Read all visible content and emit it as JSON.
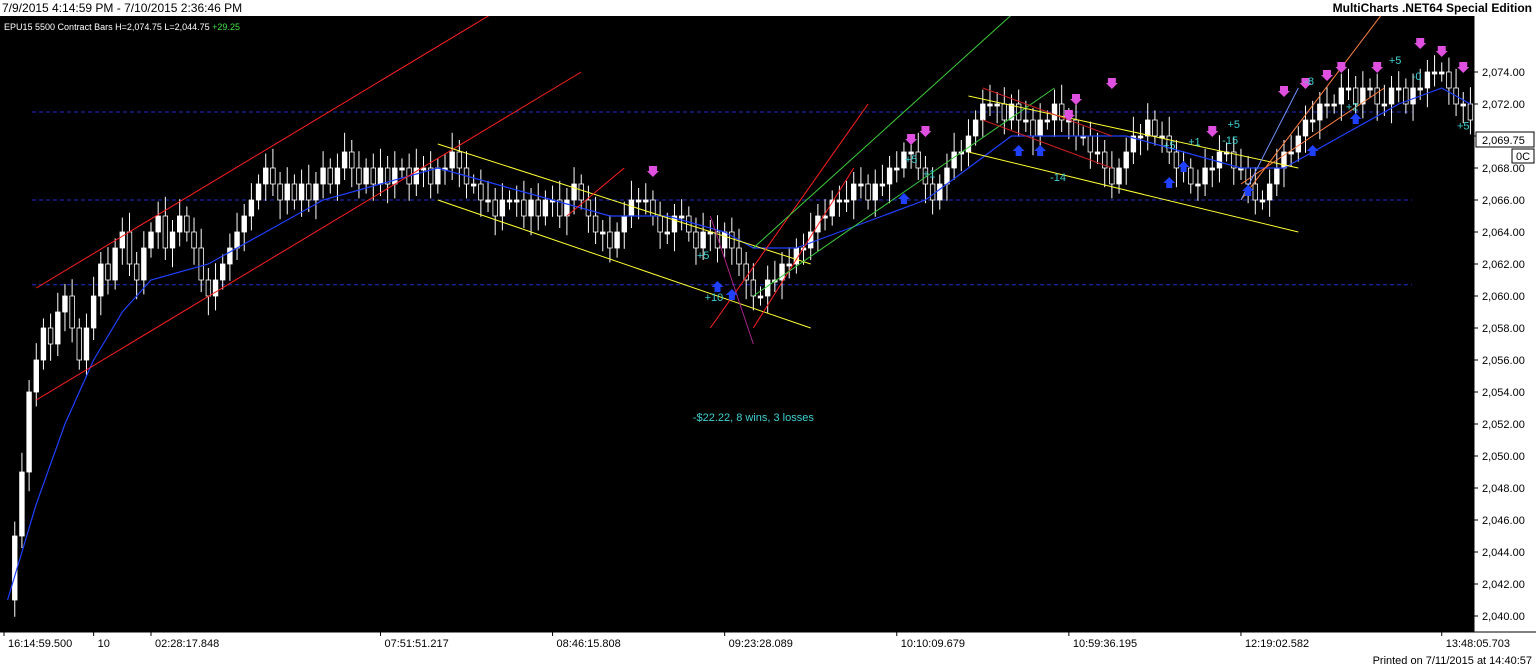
{
  "window": {
    "title_range": "7/9/2015 4:14:59 PM - 7/10/2015 2:36:46 PM",
    "app_name": "MultiCharts .NET64 Special Edition",
    "footer": "Printed on 7/11/2015 at 14:40:57"
  },
  "chart_data": {
    "type": "candlestick",
    "symbol_info": {
      "symbol": "EPU15",
      "bar_type": "5500 Contract Bars",
      "high": "H=2,074.75",
      "low": "L=2,044.75",
      "change": "+29.25"
    },
    "ylim": [
      2039,
      2077
    ],
    "y_ticks": [
      "2,040.00",
      "2,042.00",
      "2,044.00",
      "2,046.00",
      "2,048.00",
      "2,050.00",
      "2,052.00",
      "2,054.00",
      "2,056.00",
      "2,058.00",
      "2,060.00",
      "2,062.00",
      "2,064.00",
      "2,066.00",
      "2,068.00",
      "2,070.00",
      "2,072.00",
      "2,074.00"
    ],
    "y_tick_values": [
      2040,
      2042,
      2044,
      2046,
      2048,
      2050,
      2052,
      2054,
      2056,
      2058,
      2060,
      2062,
      2064,
      2066,
      2068,
      2070,
      2072,
      2074
    ],
    "last_price_label": "2,069.75",
    "last_price": 2069.75,
    "side_label": "0C",
    "x_ticks": [
      "16:14:59.500",
      "10",
      "02:28:17.848",
      "07:51:51.217",
      "08:46:15.808",
      "09:23:28.089",
      "10:10:09.679",
      "10:59:36.195",
      "12:19:02.582",
      "13:48:05.703"
    ],
    "x_tick_bars": [
      0,
      12,
      20,
      52,
      76,
      100,
      124,
      148,
      172,
      200
    ],
    "horizontal_levels": [
      2071.5,
      2066.0,
      2060.7
    ],
    "close_path": [
      [
        0,
        2041
      ],
      [
        1,
        2045
      ],
      [
        2,
        2049
      ],
      [
        3,
        2054
      ],
      [
        4,
        2056
      ],
      [
        5,
        2058
      ],
      [
        6,
        2057
      ],
      [
        7,
        2059
      ],
      [
        8,
        2060
      ],
      [
        9,
        2058
      ],
      [
        10,
        2056
      ],
      [
        11,
        2058
      ],
      [
        12,
        2060
      ],
      [
        13,
        2062
      ],
      [
        14,
        2061
      ],
      [
        15,
        2063
      ],
      [
        16,
        2064
      ],
      [
        17,
        2062
      ],
      [
        18,
        2061
      ],
      [
        19,
        2063
      ],
      [
        20,
        2064
      ],
      [
        21,
        2065
      ],
      [
        22,
        2063
      ],
      [
        23,
        2064
      ],
      [
        24,
        2065
      ],
      [
        25,
        2064
      ],
      [
        26,
        2063
      ],
      [
        27,
        2061
      ],
      [
        28,
        2060
      ],
      [
        29,
        2061
      ],
      [
        30,
        2062
      ],
      [
        31,
        2063
      ],
      [
        32,
        2064
      ],
      [
        33,
        2065
      ],
      [
        34,
        2066
      ],
      [
        35,
        2067
      ],
      [
        36,
        2068
      ],
      [
        37,
        2067
      ],
      [
        38,
        2066
      ],
      [
        39,
        2067
      ],
      [
        40,
        2066
      ],
      [
        41,
        2067
      ],
      [
        42,
        2066
      ],
      [
        43,
        2067
      ],
      [
        44,
        2068
      ],
      [
        45,
        2067
      ],
      [
        46,
        2068
      ],
      [
        47,
        2069
      ],
      [
        48,
        2068
      ],
      [
        49,
        2067
      ],
      [
        50,
        2068
      ],
      [
        51,
        2067
      ],
      [
        52,
        2068
      ],
      [
        53,
        2067
      ],
      [
        54,
        2068
      ],
      [
        55,
        2068
      ],
      [
        56,
        2067
      ],
      [
        57,
        2068
      ],
      [
        58,
        2068
      ],
      [
        59,
        2067
      ],
      [
        60,
        2068
      ],
      [
        61,
        2068
      ],
      [
        62,
        2069
      ],
      [
        63,
        2068
      ],
      [
        64,
        2067
      ],
      [
        65,
        2067
      ],
      [
        66,
        2066
      ],
      [
        67,
        2066
      ],
      [
        68,
        2065
      ],
      [
        69,
        2066
      ],
      [
        70,
        2066
      ],
      [
        71,
        2066
      ],
      [
        72,
        2065
      ],
      [
        73,
        2066
      ],
      [
        74,
        2065
      ],
      [
        75,
        2066
      ],
      [
        76,
        2066
      ],
      [
        77,
        2065
      ],
      [
        78,
        2066
      ],
      [
        79,
        2067
      ],
      [
        80,
        2066
      ],
      [
        81,
        2065
      ],
      [
        82,
        2064
      ],
      [
        83,
        2064
      ],
      [
        84,
        2063
      ],
      [
        85,
        2064
      ],
      [
        86,
        2065
      ],
      [
        87,
        2066
      ],
      [
        88,
        2066
      ],
      [
        89,
        2066
      ],
      [
        90,
        2065
      ],
      [
        91,
        2064
      ],
      [
        92,
        2064
      ],
      [
        93,
        2065
      ],
      [
        94,
        2065
      ],
      [
        95,
        2064
      ],
      [
        96,
        2063
      ],
      [
        97,
        2064
      ],
      [
        98,
        2064
      ],
      [
        99,
        2063
      ],
      [
        100,
        2064
      ],
      [
        101,
        2063
      ],
      [
        102,
        2062
      ],
      [
        103,
        2061
      ],
      [
        104,
        2060
      ],
      [
        105,
        2060
      ],
      [
        106,
        2061
      ],
      [
        107,
        2061
      ],
      [
        108,
        2062
      ],
      [
        109,
        2062
      ],
      [
        110,
        2063
      ],
      [
        111,
        2063
      ],
      [
        112,
        2064
      ],
      [
        113,
        2065
      ],
      [
        114,
        2065
      ],
      [
        115,
        2066
      ],
      [
        116,
        2066
      ],
      [
        117,
        2066
      ],
      [
        118,
        2067
      ],
      [
        119,
        2067
      ],
      [
        120,
        2066
      ],
      [
        121,
        2067
      ],
      [
        122,
        2067
      ],
      [
        123,
        2068
      ],
      [
        124,
        2068
      ],
      [
        125,
        2069
      ],
      [
        126,
        2069
      ],
      [
        127,
        2068
      ],
      [
        128,
        2067
      ],
      [
        129,
        2066
      ],
      [
        130,
        2067
      ],
      [
        131,
        2068
      ],
      [
        132,
        2069
      ],
      [
        133,
        2069
      ],
      [
        134,
        2070
      ],
      [
        135,
        2071
      ],
      [
        136,
        2072
      ],
      [
        137,
        2072
      ],
      [
        138,
        2072
      ],
      [
        139,
        2071
      ],
      [
        140,
        2072
      ],
      [
        141,
        2071
      ],
      [
        142,
        2071
      ],
      [
        143,
        2070
      ],
      [
        144,
        2071
      ],
      [
        145,
        2071
      ],
      [
        146,
        2072
      ],
      [
        147,
        2071
      ],
      [
        148,
        2071
      ],
      [
        149,
        2070
      ],
      [
        150,
        2070
      ],
      [
        151,
        2069
      ],
      [
        152,
        2069
      ],
      [
        153,
        2068
      ],
      [
        154,
        2067
      ],
      [
        155,
        2068
      ],
      [
        156,
        2069
      ],
      [
        157,
        2070
      ],
      [
        158,
        2070
      ],
      [
        159,
        2071
      ],
      [
        160,
        2070
      ],
      [
        161,
        2070
      ],
      [
        162,
        2069
      ],
      [
        163,
        2068
      ],
      [
        164,
        2068
      ],
      [
        165,
        2067
      ],
      [
        166,
        2067
      ],
      [
        167,
        2068
      ],
      [
        168,
        2068
      ],
      [
        169,
        2069
      ],
      [
        170,
        2069
      ],
      [
        171,
        2068
      ],
      [
        172,
        2068
      ],
      [
        173,
        2067
      ],
      [
        174,
        2066
      ],
      [
        175,
        2066
      ],
      [
        176,
        2067
      ],
      [
        177,
        2068
      ],
      [
        178,
        2069
      ],
      [
        179,
        2069
      ],
      [
        180,
        2070
      ],
      [
        181,
        2071
      ],
      [
        182,
        2071
      ],
      [
        183,
        2072
      ],
      [
        184,
        2072
      ],
      [
        185,
        2072
      ],
      [
        186,
        2073
      ],
      [
        187,
        2073
      ],
      [
        188,
        2072
      ],
      [
        189,
        2073
      ],
      [
        190,
        2073
      ],
      [
        191,
        2072
      ],
      [
        192,
        2072
      ],
      [
        193,
        2073
      ],
      [
        194,
        2073
      ],
      [
        195,
        2072
      ],
      [
        196,
        2073
      ],
      [
        197,
        2073
      ],
      [
        198,
        2074
      ],
      [
        199,
        2074
      ],
      [
        200,
        2074
      ],
      [
        201,
        2073
      ],
      [
        202,
        2072
      ],
      [
        203,
        2072
      ],
      [
        204,
        2071
      ]
    ],
    "ma_path": [
      [
        0,
        2041
      ],
      [
        4,
        2047
      ],
      [
        8,
        2052
      ],
      [
        12,
        2056
      ],
      [
        16,
        2059
      ],
      [
        20,
        2061
      ],
      [
        28,
        2062
      ],
      [
        36,
        2064
      ],
      [
        44,
        2066
      ],
      [
        52,
        2067
      ],
      [
        60,
        2068
      ],
      [
        68,
        2067
      ],
      [
        76,
        2066
      ],
      [
        84,
        2065
      ],
      [
        92,
        2065
      ],
      [
        100,
        2064
      ],
      [
        104,
        2063
      ],
      [
        110,
        2063
      ],
      [
        116,
        2064
      ],
      [
        122,
        2065
      ],
      [
        128,
        2066
      ],
      [
        134,
        2068
      ],
      [
        140,
        2070
      ],
      [
        148,
        2070
      ],
      [
        156,
        2070
      ],
      [
        164,
        2069
      ],
      [
        172,
        2068
      ],
      [
        178,
        2068
      ],
      [
        186,
        2070
      ],
      [
        194,
        2072
      ],
      [
        200,
        2073
      ],
      [
        204,
        2072
      ]
    ],
    "regression_channels": [
      {
        "color": "#ff2020",
        "lines": [
          [
            [
              4,
              2053.5
            ],
            [
              80,
              2074
            ]
          ],
          [
            [
              4,
              2060.5
            ],
            [
              80,
              2081
            ]
          ]
        ]
      },
      {
        "color": "#ffff33",
        "lines": [
          [
            [
              60,
              2069.5
            ],
            [
              112,
              2062
            ]
          ],
          [
            [
              60,
              2066
            ],
            [
              112,
              2058
            ]
          ]
        ]
      },
      {
        "color": "#ff2020",
        "lines": [
          [
            [
              78,
              2065
            ],
            [
              86,
              2068
            ]
          ],
          [
            [
              98,
              2058
            ],
            [
              120,
              2072
            ]
          ],
          [
            [
              104,
              2058
            ],
            [
              118,
              2068
            ]
          ]
        ]
      },
      {
        "color": "#3ccc3c",
        "lines": [
          [
            [
              104,
              2060
            ],
            [
              146,
              2073
            ]
          ],
          [
            [
              104,
              2063
            ],
            [
              146,
              2080
            ]
          ]
        ]
      },
      {
        "color": "#ffff33",
        "lines": [
          [
            [
              134,
              2072.5
            ],
            [
              180,
              2068
            ]
          ],
          [
            [
              134,
              2069
            ],
            [
              180,
              2064
            ]
          ]
        ]
      },
      {
        "color": "#cc2020",
        "lines": [
          [
            [
              136,
              2071
            ],
            [
              154,
              2068
            ]
          ],
          [
            [
              136,
              2073
            ],
            [
              154,
              2070
            ]
          ]
        ]
      },
      {
        "color": "#ff8040",
        "lines": [
          [
            [
              172,
              2066
            ],
            [
              194,
              2079
            ]
          ],
          [
            [
              172,
              2067
            ],
            [
              192,
              2073
            ]
          ]
        ]
      },
      {
        "color": "#7090ff",
        "lines": [
          [
            [
              172,
              2066
            ],
            [
              180,
              2073
            ]
          ]
        ]
      },
      {
        "color": "#aa2288",
        "lines": [
          [
            [
              98,
              2065
            ],
            [
              104,
              2057
            ]
          ]
        ]
      }
    ],
    "sell_markers": [
      [
        90,
        2067
      ],
      [
        126,
        2069
      ],
      [
        128,
        2069.5
      ],
      [
        148,
        2070.5
      ],
      [
        149,
        2071.5
      ],
      [
        154,
        2072.5
      ],
      [
        168,
        2069.5
      ],
      [
        178,
        2072
      ],
      [
        181,
        2072.5
      ],
      [
        184,
        2073
      ],
      [
        186,
        2073.5
      ],
      [
        191,
        2073.5
      ],
      [
        197,
        2075
      ],
      [
        200,
        2074.5
      ],
      [
        203,
        2073.5
      ]
    ],
    "buy_markers": [
      [
        99,
        2061
      ],
      [
        101,
        2060.5
      ],
      [
        125,
        2066.5
      ],
      [
        141,
        2069.5
      ],
      [
        144,
        2069.5
      ],
      [
        162,
        2067.5
      ],
      [
        164,
        2068.5
      ],
      [
        173,
        2067
      ],
      [
        182,
        2069.5
      ],
      [
        188,
        2071.5
      ]
    ],
    "labels": [
      {
        "text": "+5",
        "bar": 97,
        "price": 2062.3
      },
      {
        "text": "+10",
        "bar": 98.5,
        "price": 2059.7
      },
      {
        "text": "+5",
        "bar": 126,
        "price": 2068.3
      },
      {
        "text": "+1",
        "bar": 128.5,
        "price": 2067.4
      },
      {
        "text": "-14",
        "bar": 146.5,
        "price": 2067.2
      },
      {
        "text": "+5",
        "bar": 162,
        "price": 2069.2
      },
      {
        "text": "+1",
        "bar": 165.5,
        "price": 2069.4
      },
      {
        "text": "-15",
        "bar": 170.5,
        "price": 2069.5
      },
      {
        "text": "+5",
        "bar": 171,
        "price": 2070.5
      },
      {
        "text": "-8",
        "bar": 181.5,
        "price": 2073.2
      },
      {
        "text": "+2",
        "bar": 187.5,
        "price": 2071.6
      },
      {
        "text": "+5",
        "bar": 193.5,
        "price": 2074.5
      },
      {
        "text": "-0",
        "bar": 196.5,
        "price": 2073.5
      },
      {
        "text": "+5",
        "bar": 203,
        "price": 2070.4
      }
    ],
    "summary_label": "-$22.22, 8 wins, 3 losses",
    "summary_position": {
      "bar": 104,
      "price": 2052.2
    }
  }
}
